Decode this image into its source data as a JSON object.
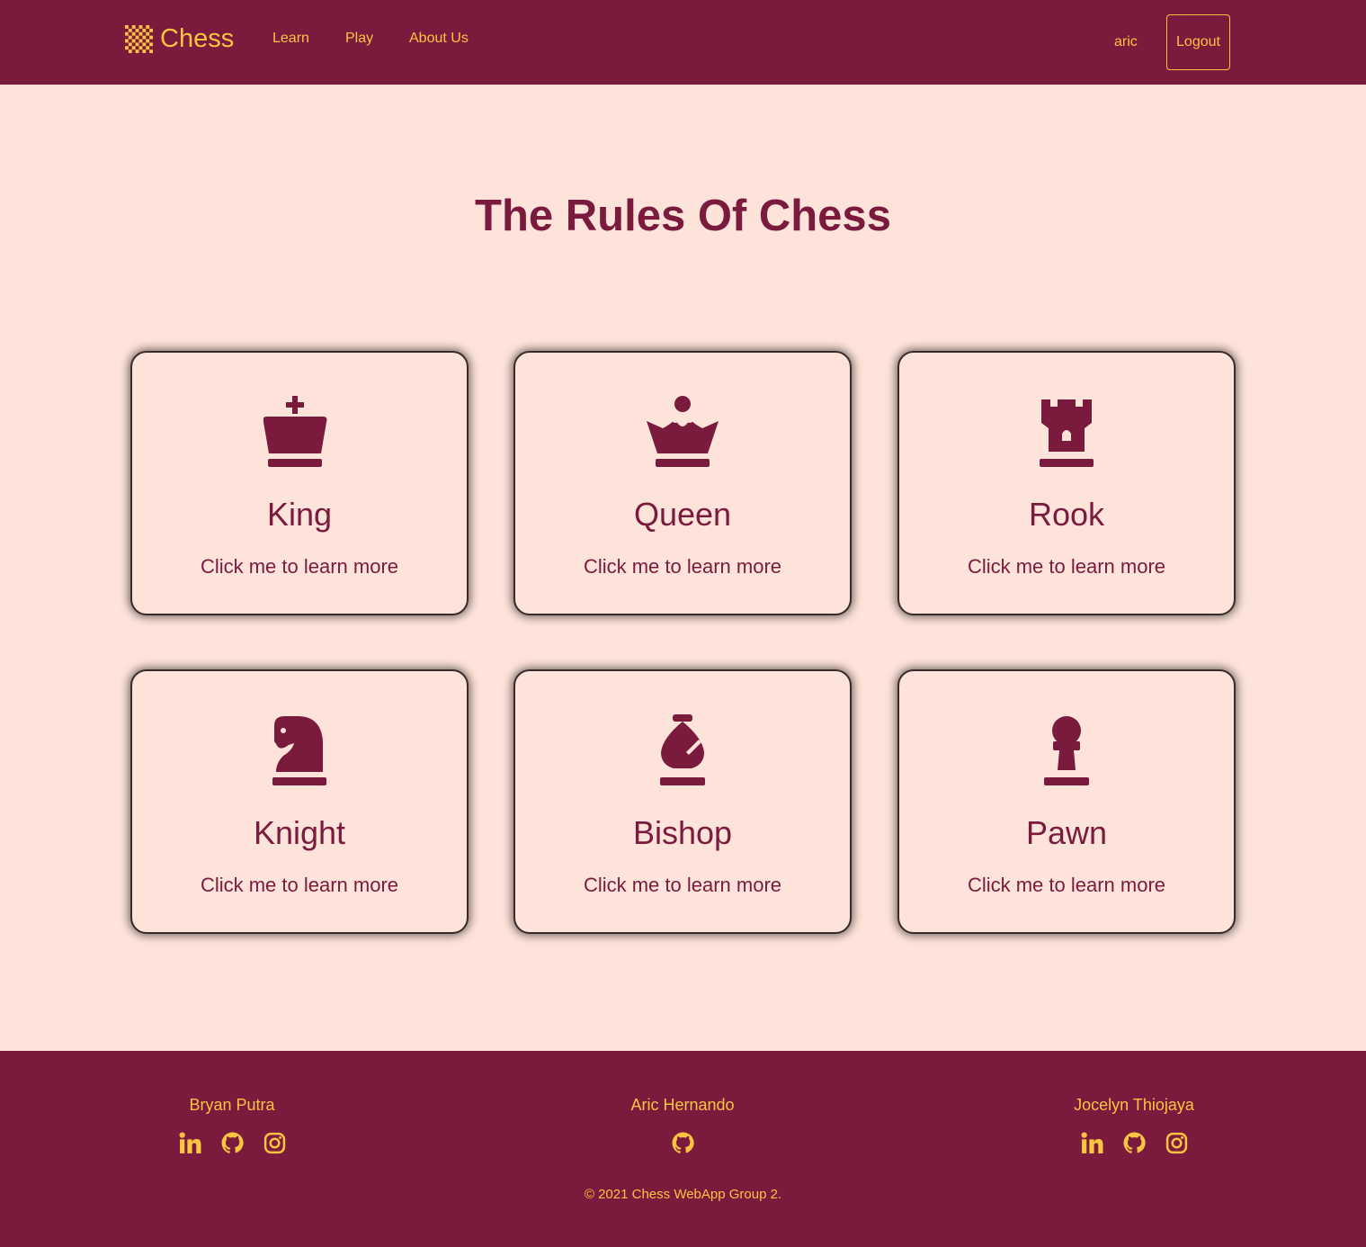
{
  "nav": {
    "brand": "Chess",
    "brand_icon": "chessboard-icon",
    "links": [
      "Learn",
      "Play",
      "About Us"
    ],
    "username": "aric",
    "logout_label": "Logout"
  },
  "main": {
    "title": "The Rules Of Chess",
    "cards": [
      {
        "title": "King",
        "subtitle": "Click me to learn more",
        "icon": "chess-king-icon"
      },
      {
        "title": "Queen",
        "subtitle": "Click me to learn more",
        "icon": "chess-queen-icon"
      },
      {
        "title": "Rook",
        "subtitle": "Click me to learn more",
        "icon": "chess-rook-icon"
      },
      {
        "title": "Knight",
        "subtitle": "Click me to learn more",
        "icon": "chess-knight-icon"
      },
      {
        "title": "Bishop",
        "subtitle": "Click me to learn more",
        "icon": "chess-bishop-icon"
      },
      {
        "title": "Pawn",
        "subtitle": "Click me to learn more",
        "icon": "chess-pawn-icon"
      }
    ]
  },
  "footer": {
    "members": [
      {
        "name": "Bryan Putra",
        "socials": [
          "linkedin-icon",
          "github-icon",
          "instagram-icon"
        ]
      },
      {
        "name": "Aric Hernando",
        "socials": [
          "github-icon"
        ]
      },
      {
        "name": "Jocelyn Thiojaya",
        "socials": [
          "linkedin-icon",
          "github-icon",
          "instagram-icon"
        ]
      }
    ],
    "copyright": "© 2021 Chess WebApp Group 2."
  },
  "colors": {
    "primary": "#7a1a3d",
    "accent": "#fcc440",
    "background": "#fde3d9"
  }
}
